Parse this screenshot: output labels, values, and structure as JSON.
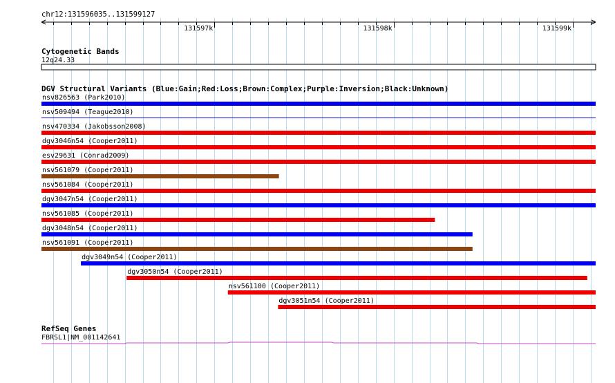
{
  "header": {
    "location": "chr12:131596035..131599127"
  },
  "ruler": {
    "start": 131596035,
    "end": 131599127,
    "tick_labels": [
      {
        "text": "131597k",
        "pos": 131597000
      },
      {
        "text": "131598k",
        "pos": 131598000
      },
      {
        "text": "131599k",
        "pos": 131599000
      }
    ]
  },
  "tracks": {
    "cytobands": {
      "title": "Cytogenetic Bands",
      "band_label": "12q24.33"
    },
    "dgv": {
      "title": "DGV Structural Variants (Blue:Gain;Red:Loss;Brown:Complex;Purple:Inversion;Black:Unknown)",
      "colors": {
        "gain": "#0000ee",
        "loss": "#ee0000",
        "complex": "#8b4513",
        "inversion": "#800080",
        "unknown": "#000000"
      },
      "features": [
        {
          "label": "nsv826563 (Park2010)",
          "type": "gain",
          "start": 131596035,
          "end": 131599127
        },
        {
          "label": "nsv509494 (Teague2010)",
          "type": "gain",
          "start": 131596035,
          "end": 131599127,
          "style": "line"
        },
        {
          "label": "nsv470334 (Jakobsson2008)",
          "type": "loss",
          "start": 131596035,
          "end": 131599127
        },
        {
          "label": "dgv3046n54 (Cooper2011)",
          "type": "loss",
          "start": 131596035,
          "end": 131599127
        },
        {
          "label": "esv29631 (Conrad2009)",
          "type": "loss",
          "start": 131596035,
          "end": 131599127
        },
        {
          "label": "nsv561079 (Cooper2011)",
          "type": "complex",
          "start": 131596035,
          "end": 131597360
        },
        {
          "label": "nsv561084 (Cooper2011)",
          "type": "loss",
          "start": 131596035,
          "end": 131599127
        },
        {
          "label": "dgv3047n54 (Cooper2011)",
          "type": "gain",
          "start": 131596035,
          "end": 131599127
        },
        {
          "label": "nsv561085 (Cooper2011)",
          "type": "loss",
          "start": 131596035,
          "end": 131598230
        },
        {
          "label": "dgv3048n54 (Cooper2011)",
          "type": "gain",
          "start": 131596035,
          "end": 131598440
        },
        {
          "label": "nsv561091 (Cooper2011)",
          "type": "complex",
          "start": 131596035,
          "end": 131598440
        },
        {
          "label": "dgv3049n54 (Cooper2011)",
          "type": "gain",
          "start": 131596255,
          "end": 131599127
        },
        {
          "label": "dgv3050n54 (Cooper2011)",
          "type": "loss",
          "start": 131596510,
          "end": 131599080
        },
        {
          "label": "nsv561100 (Cooper2011)",
          "type": "loss",
          "start": 131597075,
          "end": 131599127
        },
        {
          "label": "dgv3051n54 (Cooper2011)",
          "type": "loss",
          "start": 131597355,
          "end": 131599127
        }
      ]
    },
    "refseq": {
      "title": "RefSeq Genes",
      "gene_label": "FBRSL1|NM_001142641",
      "color": "#cc44cc"
    }
  }
}
